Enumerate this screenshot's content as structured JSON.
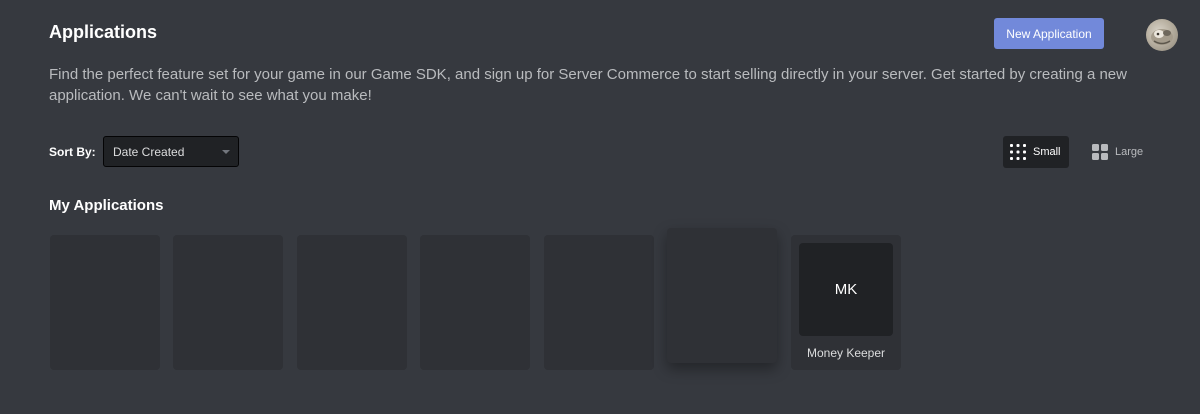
{
  "header": {
    "title": "Applications",
    "new_app_label": "New Application"
  },
  "description": "Find the perfect feature set for your game in our Game SDK, and sign up for Server Commerce to start selling directly in your server. Get started by creating a new application. We can't wait to see what you make!",
  "sort": {
    "label": "Sort By:",
    "selected": "Date Created"
  },
  "view": {
    "small_label": "Small",
    "large_label": "Large",
    "active": "small"
  },
  "section": {
    "title": "My Applications"
  },
  "apps": [
    {
      "initials": "",
      "name": ""
    },
    {
      "initials": "",
      "name": ""
    },
    {
      "initials": "",
      "name": ""
    },
    {
      "initials": "",
      "name": ""
    },
    {
      "initials": "",
      "name": ""
    },
    {
      "initials": "",
      "name": ""
    },
    {
      "initials": "MK",
      "name": "Money Keeper"
    }
  ],
  "colors": {
    "background": "#36393f",
    "card": "#2f3136",
    "accent": "#7289da",
    "input": "#202225"
  },
  "icons": [
    "avatar",
    "grid-small-icon",
    "grid-large-icon",
    "chevron-down-icon"
  ]
}
